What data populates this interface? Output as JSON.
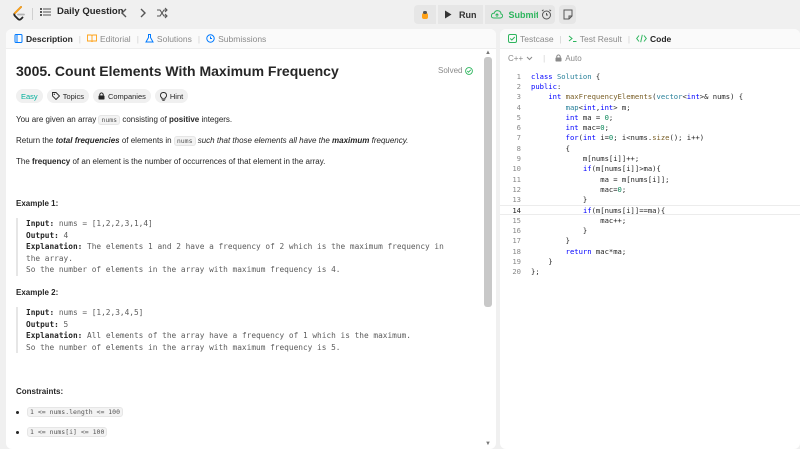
{
  "topbar": {
    "daily_label": "Daily Question",
    "run_label": "Run",
    "submit_label": "Submit"
  },
  "left_tabs": [
    {
      "label": "Description"
    },
    {
      "label": "Editorial"
    },
    {
      "label": "Solutions"
    },
    {
      "label": "Submissions"
    }
  ],
  "problem": {
    "title": "3005. Count Elements With Maximum Frequency",
    "status": "Solved",
    "tags": [
      "Easy",
      "Topics",
      "Companies",
      "Hint"
    ],
    "p1a": "You are given an array ",
    "p1code": "nums",
    "p1b": " consisting of ",
    "p1bold": "positive",
    "p1c": " integers.",
    "p2a": "Return the ",
    "p2bold": "total frequencies",
    "p2b": " of elements in ",
    "p2code": "nums",
    "p2c": " such that those elements all have the ",
    "p2bold2": "maximum",
    "p2d": " frequency.",
    "p3a": "The ",
    "p3bold": "frequency",
    "p3b": " of an element is the number of occurrences of that element in the array.",
    "ex1_title": "Example 1:",
    "ex1_input_label": "Input:",
    "ex1_input": " nums = [1,2,2,3,1,4]",
    "ex1_output_label": "Output:",
    "ex1_output": " 4",
    "ex1_expl_label": "Explanation:",
    "ex1_expl1": " The elements 1 and 2 have a frequency of 2 which is the maximum frequency in",
    "ex1_expl2": "the array.",
    "ex1_expl3": "So the number of elements in the array with maximum frequency is 4.",
    "ex2_title": "Example 2:",
    "ex2_input_label": "Input:",
    "ex2_input": " nums = [1,2,3,4,5]",
    "ex2_output_label": "Output:",
    "ex2_output": " 5",
    "ex2_expl_label": "Explanation:",
    "ex2_expl1": " All elements of the array have a frequency of 1 which is the maximum.",
    "ex2_expl2": "So the number of elements in the array with maximum frequency is 5.",
    "constraints_title": "Constraints:",
    "c1": "1 <= nums.length <= 100",
    "c2": "1 <= nums[i] <= 100"
  },
  "right_tabs": [
    {
      "label": "Testcase"
    },
    {
      "label": "Test Result"
    },
    {
      "label": "Code"
    }
  ],
  "editor": {
    "language": "C++",
    "mode": "Auto",
    "current_line": 14,
    "lines": [
      "class Solution {",
      "public:",
      "    int maxFrequencyElements(vector<int>& nums) {",
      "        map<int,int> m;",
      "        int ma = 0;",
      "        int mac=0;",
      "        for(int i=0; i<nums.size(); i++)",
      "        {",
      "            m[nums[i]]++;",
      "            if(m[nums[i]]>ma){",
      "                ma = m[nums[i]];",
      "                mac=0;",
      "            }",
      "            if(m[nums[i]]==ma){",
      "                mac++;",
      "            }",
      "        }",
      "        return mac*ma;",
      "    }",
      "};"
    ]
  },
  "colors": {
    "accent_submit": "#2db55d",
    "easy": "#00af9b",
    "code_tab_icon": "#2db55d",
    "description_icon": "#007aff",
    "editorial_icon": "#ffa116",
    "solutions_icon": "#007aff",
    "submissions_icon": "#007aff",
    "testcase_icon": "#2db55d"
  },
  "icons": [
    "leetcode-logo-icon",
    "list-icon",
    "chevron-left-icon",
    "chevron-right-icon",
    "shuffle-icon",
    "bug-icon",
    "play-icon",
    "cloud-upload-icon",
    "alarm-icon",
    "note-icon",
    "book-icon",
    "flask-icon",
    "history-icon",
    "check-circle-icon",
    "tag-icon",
    "lock-icon",
    "bulb-icon",
    "checkbox-icon",
    "terminal-icon",
    "code-icon",
    "lock-small-icon"
  ]
}
